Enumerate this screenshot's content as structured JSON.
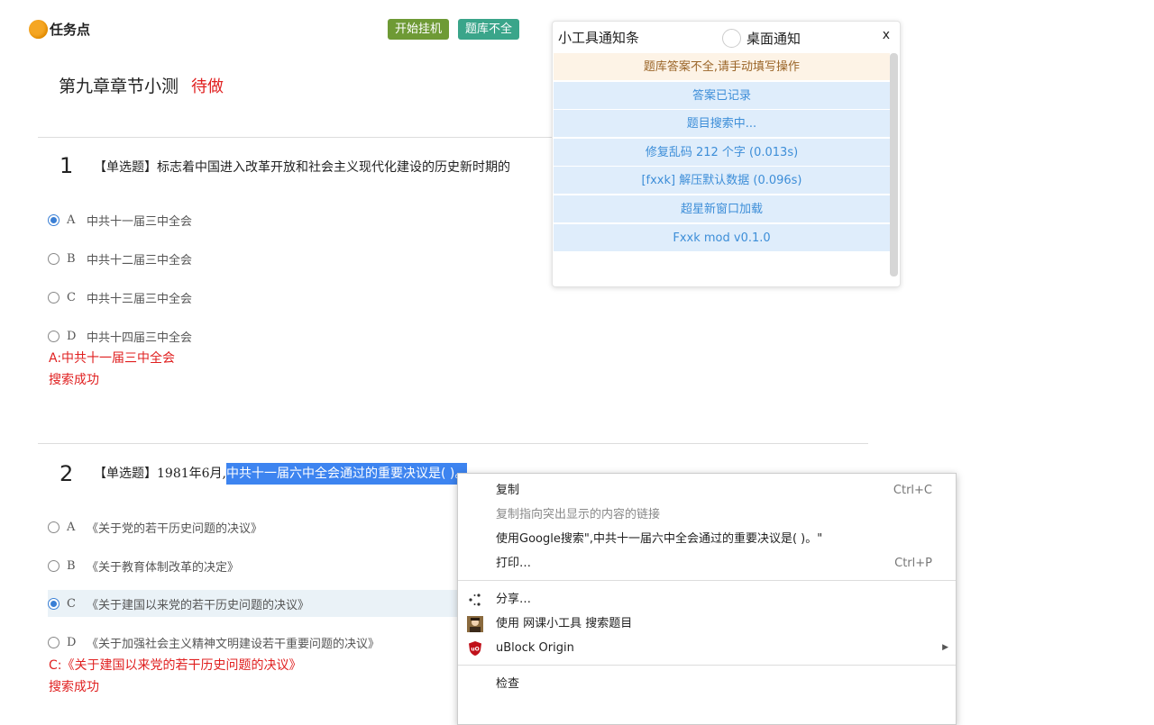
{
  "header": {
    "logo_text": "任务点",
    "btn_start": "开始挂机",
    "btn_bank": "题库不全"
  },
  "title": {
    "text": "第九章章节小测",
    "status": "待做"
  },
  "questions": [
    {
      "number": "1",
      "type": "【单选题】",
      "text": "标志着中国进入改革开放和社会主义现代化建设的历史新时期的",
      "options": [
        {
          "letter": "A",
          "text": "中共十一届三中全会"
        },
        {
          "letter": "B",
          "text": "中共十二届三中全会"
        },
        {
          "letter": "C",
          "text": "中共十三届三中全会"
        },
        {
          "letter": "D",
          "text": "中共十四届三中全会"
        }
      ],
      "answer": "A:中共十一届三中全会",
      "result": "搜索成功"
    },
    {
      "number": "2",
      "type": "【单选题】",
      "text_prefix": "1981年6月,",
      "text_selected": "中共十一届六中全会通过的重要决议是( )。",
      "options": [
        {
          "letter": "A",
          "text": "《关于党的若干历史问题的决议》"
        },
        {
          "letter": "B",
          "text": "《关于教育体制改革的决定》"
        },
        {
          "letter": "C",
          "text": "《关于建国以来党的若干历史问题的决议》"
        },
        {
          "letter": "D",
          "text": "《关于加强社会主义精神文明建设若干重要问题的决议》"
        }
      ],
      "answer": "C:《关于建国以来党的若干历史问题的决议》",
      "result": "搜索成功"
    }
  ],
  "panel": {
    "title": "小工具通知条",
    "toggle_label": "桌面通知",
    "close": "x",
    "messages": [
      {
        "text": "题库答案不全,请手动填写操作",
        "kind": "warn"
      },
      {
        "text": "答案已记录",
        "kind": "info"
      },
      {
        "text": "题目搜索中...",
        "kind": "info"
      },
      {
        "text": "修复乱码 212 个字 (0.013s)",
        "kind": "info"
      },
      {
        "text": "[fxxk] 解压默认数据 (0.096s)",
        "kind": "info"
      },
      {
        "text": "超星新窗口加载",
        "kind": "info"
      },
      {
        "text": "Fxxk mod v0.1.0",
        "kind": "info"
      }
    ]
  },
  "context_menu": {
    "copy": "复制",
    "copy_shortcut": "Ctrl+C",
    "copy_link": "复制指向突出显示的内容的链接",
    "google_search": "使用Google搜索\",中共十一届六中全会通过的重要决议是( )。\"",
    "print": "打印…",
    "print_shortcut": "Ctrl+P",
    "share": "分享…",
    "tool_search": "使用 网课小工具 搜索题目",
    "ublock": "uBlock Origin",
    "inspect": "检查"
  },
  "colors": {
    "accent_blue": "#3a7fd5",
    "answer_red": "#e02020",
    "btn_green": "#6e9a35",
    "btn_teal": "#3aa58a"
  },
  "checked": {
    "q1": "A",
    "q2": "C"
  }
}
